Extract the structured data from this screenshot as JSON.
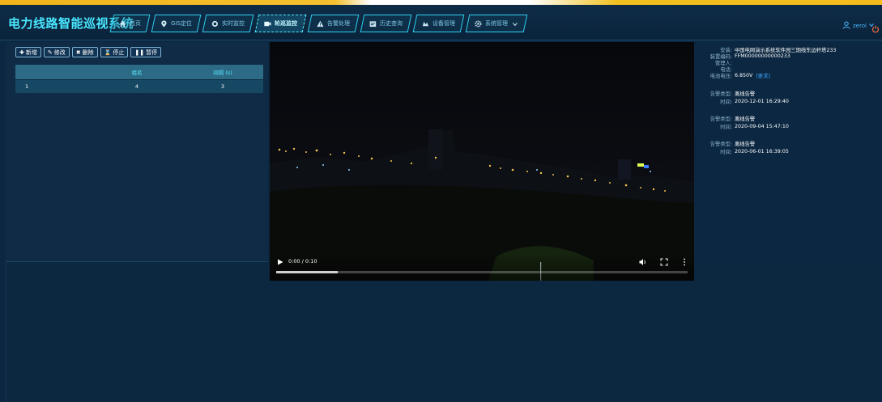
{
  "colors": {
    "accent": "#49e7ff",
    "nav_border": "#2fd0f0",
    "header_bg": "#0f2c47",
    "table_header": "#2d6a85",
    "table_row": "#174863",
    "link": "#3fa6ff"
  },
  "header": {
    "title": "电力线路智能巡视系统",
    "nav": [
      {
        "label": "首页",
        "icon": "home-icon"
      },
      {
        "label": "GIS定位",
        "icon": "location-pin-icon"
      },
      {
        "label": "实时监控",
        "icon": "camera-icon"
      },
      {
        "label": "轮巡监控",
        "icon": "video-icon",
        "active": true
      },
      {
        "label": "告警处理",
        "icon": "warning-icon"
      },
      {
        "label": "历史查询",
        "icon": "history-icon"
      },
      {
        "label": "设备管理",
        "icon": "device-icon"
      },
      {
        "label": "系统管理",
        "icon": "gear-icon",
        "has_dropdown": true
      }
    ],
    "user": {
      "name": "zeroi",
      "icon": "user-icon"
    }
  },
  "toolbar": {
    "buttons": [
      {
        "label": "新增",
        "icon": "plus-icon"
      },
      {
        "label": "修改",
        "icon": "edit-icon"
      },
      {
        "label": "删除",
        "icon": "x-icon"
      },
      {
        "label": "停止",
        "icon": "hourglass-icon"
      },
      {
        "label": "暂停",
        "icon": "pause-icon"
      }
    ]
  },
  "table": {
    "columns": [
      "",
      "组名",
      "间隔 (s)"
    ],
    "rows": [
      [
        "1",
        "4",
        "3"
      ]
    ]
  },
  "video": {
    "time": "0:00 / 0:10",
    "progress_fraction": 0.15
  },
  "info": {
    "fields": [
      {
        "label": "安装:",
        "value": "中国电网演示系统软件园三期线东边杆塔233"
      },
      {
        "label": "装置编码:",
        "value": "FFM00000000000233"
      },
      {
        "label": "管理人:",
        "value": ""
      },
      {
        "label": "电话:",
        "value": ""
      },
      {
        "label": "电池电压:",
        "value": "6.850V",
        "link": "[要求]"
      }
    ],
    "alarms": [
      {
        "type_label": "告警类型:",
        "type": "离线告警",
        "time_label": "时间:",
        "time": "2020-12-01 16:29:40"
      },
      {
        "type_label": "告警类型:",
        "type": "离线告警",
        "time_label": "时间:",
        "time": "2020-09-04 15:47:10"
      },
      {
        "type_label": "告警类型:",
        "type": "离线告警",
        "time_label": "时间:",
        "time": "2020-06-01 16:39:05"
      }
    ]
  }
}
